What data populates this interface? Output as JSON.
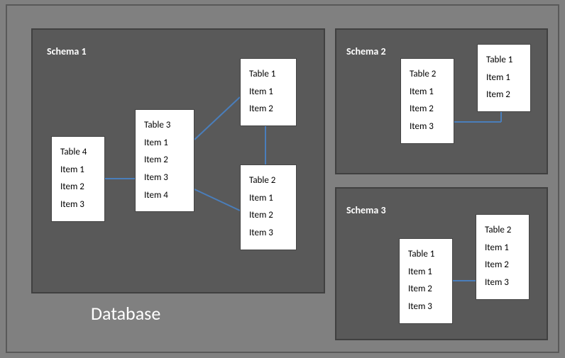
{
  "dbLabel": "Database",
  "schema1": {
    "title": "Schema 1",
    "tables": {
      "t4": {
        "name": "Table 4",
        "items": [
          "Item 1",
          "Item 2",
          "Item 3"
        ]
      },
      "t3": {
        "name": "Table 3",
        "items": [
          "Item 1",
          "Item 2",
          "Item 3",
          "Item 4"
        ]
      },
      "t1": {
        "name": "Table 1",
        "items": [
          "Item 1",
          "Item 2"
        ]
      },
      "t2": {
        "name": "Table 2",
        "items": [
          "Item 1",
          "Item 2",
          "Item 3"
        ]
      }
    }
  },
  "schema2": {
    "title": "Schema 2",
    "tables": {
      "t2": {
        "name": "Table 2",
        "items": [
          "Item 1",
          "Item 2",
          "Item 3"
        ]
      },
      "t1": {
        "name": "Table 1",
        "items": [
          "Item 1",
          "Item 2"
        ]
      }
    }
  },
  "schema3": {
    "title": "Schema 3",
    "tables": {
      "t1": {
        "name": "Table 1",
        "items": [
          "Item 1",
          "Item 2",
          "Item 3"
        ]
      },
      "t2": {
        "name": "Table 2",
        "items": [
          "Item 1",
          "Item 2",
          "Item 3"
        ]
      }
    }
  }
}
